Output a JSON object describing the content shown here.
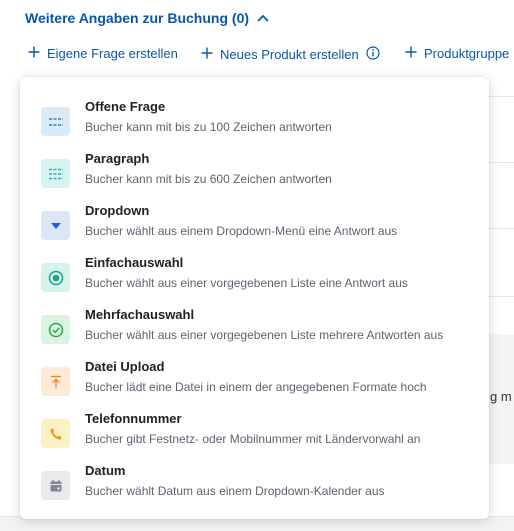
{
  "section": {
    "title": "Weitere Angaben zur Buchung (0)",
    "expanded": true
  },
  "toolbar": {
    "items": [
      {
        "label": "Eigene Frage erstellen",
        "icon": "plus-icon"
      },
      {
        "label": "Neues Produkt erstellen",
        "icon": "plus-icon",
        "info_icon": "info-icon"
      },
      {
        "label": "Produktgruppe",
        "icon": "plus-icon"
      }
    ]
  },
  "background": {
    "clipped_text": "g m"
  },
  "question_types": [
    {
      "label": "Offene Frage",
      "description": "Bucher kann mit bis zu 100 Zeichen antworten",
      "icon": "short-text-icon",
      "icon_bg": "#dbeaf7",
      "icon_color": "#2f86c9"
    },
    {
      "label": "Paragraph",
      "description": "Bucher kann mit bis zu 600 Zeichen antworten",
      "icon": "paragraph-icon",
      "icon_bg": "#d9f3f3",
      "icon_color": "#2bb3b3"
    },
    {
      "label": "Dropdown",
      "description": "Bucher wählt aus einem Dropdown-Menü eine Antwort aus",
      "icon": "dropdown-icon",
      "icon_bg": "#dce6f7",
      "icon_color": "#1f64c8"
    },
    {
      "label": "Einfachauswahl",
      "description": "Bucher wählt aus einer vorgegebenen Liste eine Antwort aus",
      "icon": "radio-icon",
      "icon_bg": "#d6f2ec",
      "icon_color": "#13a78a"
    },
    {
      "label": "Mehrfachauswahl",
      "description": "Bucher wählt aus einer vorgegebenen Liste mehrere Antworten aus",
      "icon": "check-circle-icon",
      "icon_bg": "#dcf3e0",
      "icon_color": "#2fa84f"
    },
    {
      "label": "Datei Upload",
      "description": "Bucher lädt eine Datei in einem der angegebenen Formate hoch",
      "icon": "upload-icon",
      "icon_bg": "#fdebd7",
      "icon_color": "#ef8a22"
    },
    {
      "label": "Telefonnummer",
      "description": "Bucher gibt Festnetz- oder Mobilnummer mit Ländervorwahl an",
      "icon": "phone-icon",
      "icon_bg": "#fbf1c4",
      "icon_color": "#e8a10d"
    },
    {
      "label": "Datum",
      "description": "Bucher wählt Datum aus einem Dropdown-Kalender aus",
      "icon": "calendar-icon",
      "icon_bg": "#e8eaee",
      "icon_color": "#7c8591"
    }
  ]
}
